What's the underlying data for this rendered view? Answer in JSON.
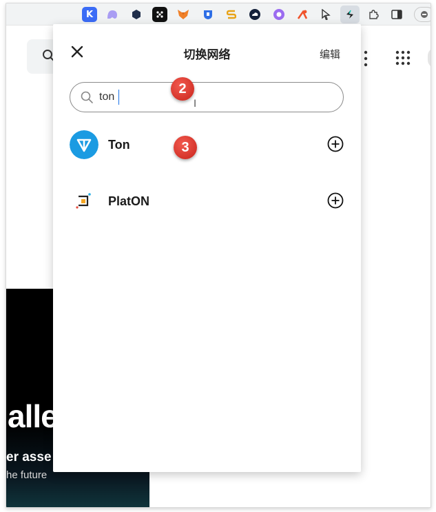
{
  "panel": {
    "title": "切换网络",
    "edit_label": "编辑"
  },
  "search": {
    "value": "ton",
    "placeholder": ""
  },
  "networks": [
    {
      "name": "Ton",
      "icon": "ton-logo-icon",
      "color": "#1b9be2"
    },
    {
      "name": "PlatON",
      "icon": "platon-logo-icon",
      "color": "#f5a623"
    }
  ],
  "annotations": {
    "step2": "2",
    "step3": "3"
  },
  "background": {
    "hero_text": "alle",
    "sub_text_1": "er asse",
    "sub_text_2": "he future"
  },
  "toolbar": {
    "extensions": [
      "k-extension-icon",
      "ghost-extension-icon",
      "hex-extension-icon",
      "dice-extension-icon",
      "metamask-fox-icon",
      "shield-extension-icon",
      "s-extension-icon",
      "cloud-extension-icon",
      "purple-extension-icon",
      "tool-extension-icon",
      "cursor-extension-icon",
      "active-wallet-extension-icon",
      "puzzle-icon",
      "sidepanel-icon",
      "profile-icon"
    ]
  },
  "colors": {
    "badge_red": "#d9342a",
    "ton_blue": "#1b9be2",
    "search_border": "#8a8a8a"
  }
}
